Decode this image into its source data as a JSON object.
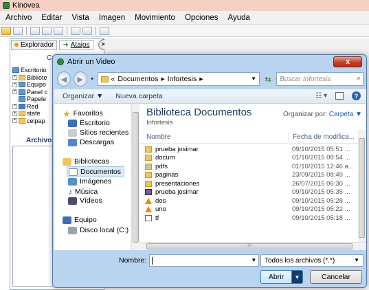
{
  "app": {
    "title": "Kinovea",
    "menu": [
      "Archivo",
      "Editar",
      "Vista",
      "Imagen",
      "Movimiento",
      "Opciones",
      "Ayuda"
    ],
    "left_tabs": {
      "explorer": "Explorador",
      "shortcuts": "Atajos"
    },
    "tree_caption": "Car",
    "tree_items": [
      "Escritorio",
      "Bibliote",
      "Equipo",
      "Panel c",
      "Papele",
      "Red",
      "stafe",
      "celpap"
    ],
    "files_caption": "Archivo"
  },
  "dialog": {
    "title": "Abrir un Video",
    "close_label": "x",
    "breadcrumb": {
      "prefix": "«",
      "segment1": "Documentos",
      "sep": "▸",
      "segment2": "Infortesis"
    },
    "search_placeholder": "Buscar Infortesis",
    "commands": {
      "organize": "Organizar ▼",
      "new_folder": "Nueva carpeta"
    },
    "navigation": {
      "favorites": "Favoritos",
      "favorites_items": [
        "Escritorio",
        "Sitios recientes",
        "Descargas"
      ],
      "libraries": "Bibliotecas",
      "libraries_items": [
        "Documentos",
        "Imágenes",
        "Música",
        "Vídeos"
      ],
      "computer": "Equipo",
      "computer_items": [
        "Disco local (C:)"
      ]
    },
    "library": {
      "title": "Biblioteca Documentos",
      "subtitle": "Infortesis",
      "arrange_label": "Organizar por:",
      "arrange_value": "Carpeta ▼"
    },
    "columns": {
      "name": "Nombre",
      "date": "Fecha de modifica..."
    },
    "files": [
      {
        "name": "prueba josimar",
        "date": "09/10/2015 05:51 ...",
        "icon": "folder"
      },
      {
        "name": "docum",
        "date": "01/10/2015 08:54 ...",
        "icon": "folder"
      },
      {
        "name": "pdfs",
        "date": "01/10/2015 12:46 a...",
        "icon": "pdf-folder"
      },
      {
        "name": "paginas",
        "date": "23/09/2015 08:49 ...",
        "icon": "folder"
      },
      {
        "name": "presentaciones",
        "date": "26/07/2015 06:30 ...",
        "icon": "folder"
      },
      {
        "name": "prueba josimar",
        "date": "09/10/2015 05:35 ...",
        "icon": "rar"
      },
      {
        "name": "dos",
        "date": "09/10/2015 05:28 ...",
        "icon": "vlc"
      },
      {
        "name": "uno",
        "date": "09/10/2015 05:22 ...",
        "icon": "vlc"
      },
      {
        "name": "tf",
        "date": "09/10/2015 05:18 ...",
        "icon": "doc"
      }
    ],
    "hscroll_label": "III",
    "filename_label": "Nombre:",
    "filename_value": "",
    "filter_value": "Todos los archivos (*.*)",
    "open_label": "Abrir",
    "cancel_label": "Cancelar"
  }
}
